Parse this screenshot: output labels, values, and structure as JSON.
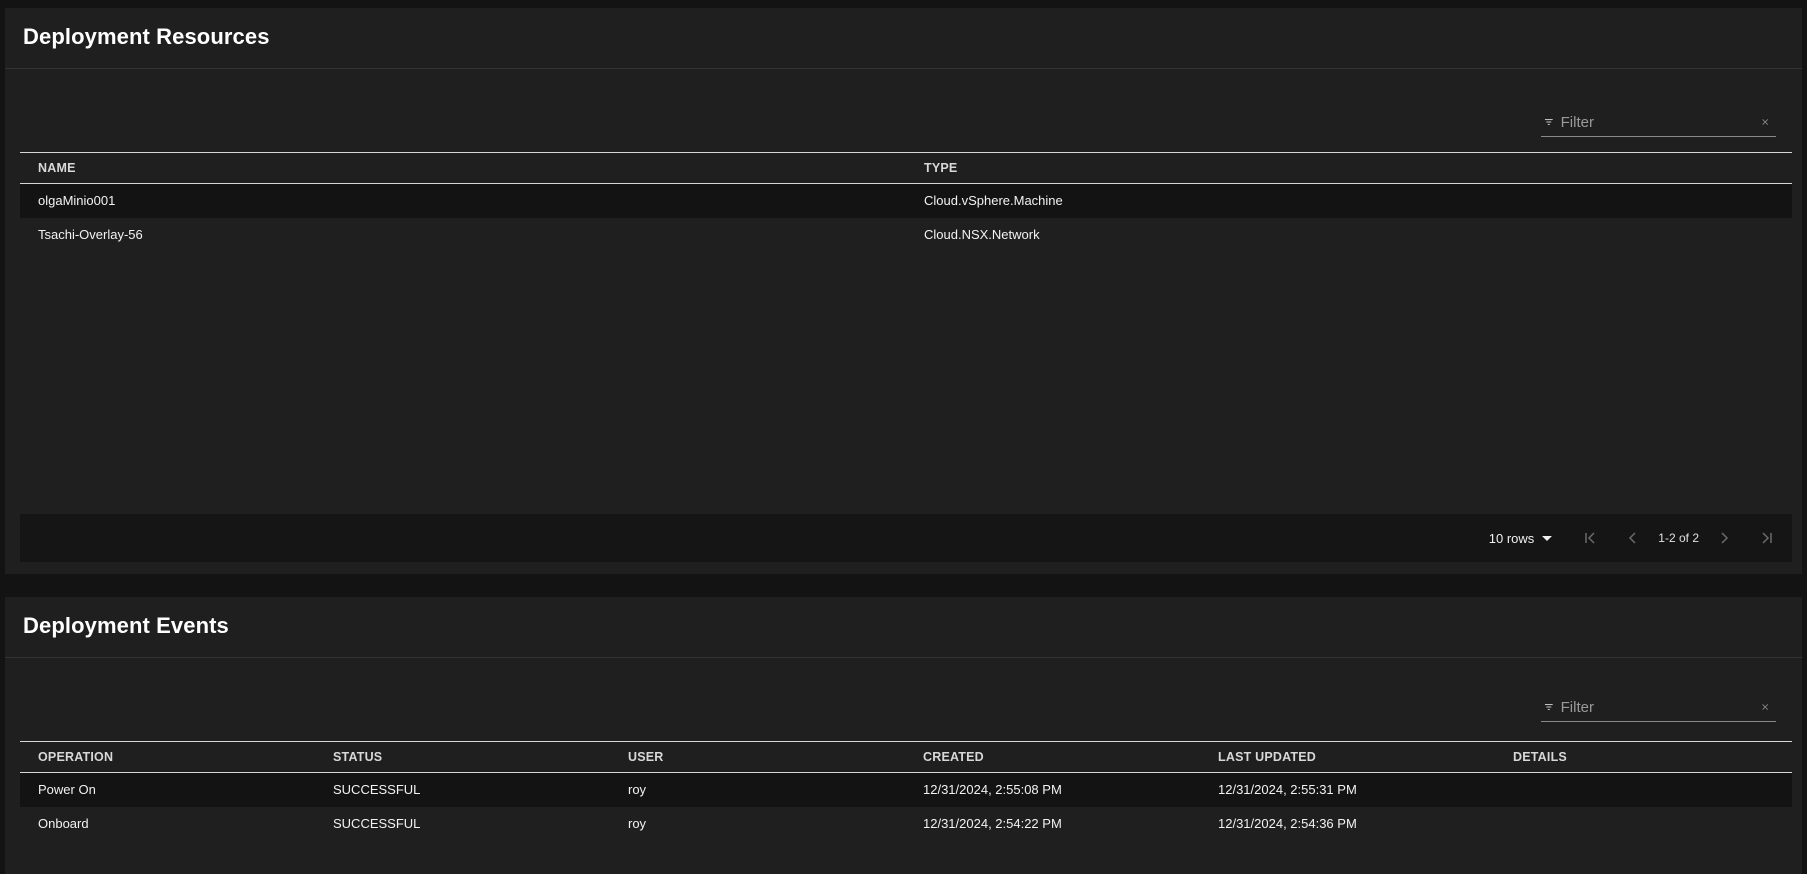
{
  "resources": {
    "title": "Deployment Resources",
    "filter_placeholder": "Filter",
    "columns": [
      "NAME",
      "TYPE"
    ],
    "rows": [
      {
        "name": "olgaMinio001",
        "type": "Cloud.vSphere.Machine"
      },
      {
        "name": "Tsachi-Overlay-56",
        "type": "Cloud.NSX.Network"
      }
    ],
    "pagination": {
      "rows_per_page": "10 rows",
      "range": "1-2 of 2"
    }
  },
  "events": {
    "title": "Deployment Events",
    "filter_placeholder": "Filter",
    "columns": [
      "OPERATION",
      "STATUS",
      "USER",
      "CREATED",
      "LAST UPDATED",
      "DETAILS"
    ],
    "rows": [
      {
        "operation": "Power On",
        "status": "SUCCESSFUL",
        "user": "roy",
        "created": "12/31/2024, 2:55:08 PM",
        "last_updated": "12/31/2024, 2:55:31 PM",
        "details": ""
      },
      {
        "operation": "Onboard",
        "status": "SUCCESSFUL",
        "user": "roy",
        "created": "12/31/2024, 2:54:22 PM",
        "last_updated": "12/31/2024, 2:54:36 PM",
        "details": ""
      }
    ]
  },
  "icons": {
    "filter": "filter-icon",
    "clear": "close-icon",
    "first_page": "first-page-icon",
    "prev_page": "chevron-left-icon",
    "next_page": "chevron-right-icon",
    "last_page": "last-page-icon",
    "dropdown": "caret-down-icon"
  },
  "colors": {
    "page_bg": "#131313",
    "panel_bg": "#1f1f1f",
    "stripe_bg": "#131313",
    "text": "#f2f2f2"
  }
}
